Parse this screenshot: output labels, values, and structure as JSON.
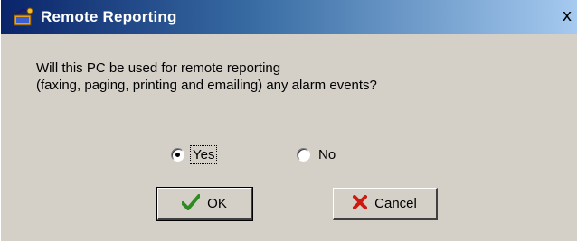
{
  "window": {
    "title": "Remote Reporting",
    "close_glyph": "x",
    "title_icon": "remote-reporting-app-icon"
  },
  "message": {
    "line1": "Will this PC be used for remote reporting",
    "line2": "(faxing, paging, printing and emailing) any alarm events?"
  },
  "options": {
    "yes_label": "Yes",
    "no_label": "No",
    "selected": "Yes"
  },
  "buttons": {
    "ok_label": "OK",
    "ok_icon": "checkmark-icon",
    "cancel_label": "Cancel",
    "cancel_icon": "x-mark-icon"
  },
  "colors": {
    "title_gradient_start": "#0a246a",
    "title_gradient_end": "#a6caf0",
    "dialog_face": "#d4d0c8",
    "check_green": "#2e8b22",
    "cancel_red": "#cc1a10"
  }
}
